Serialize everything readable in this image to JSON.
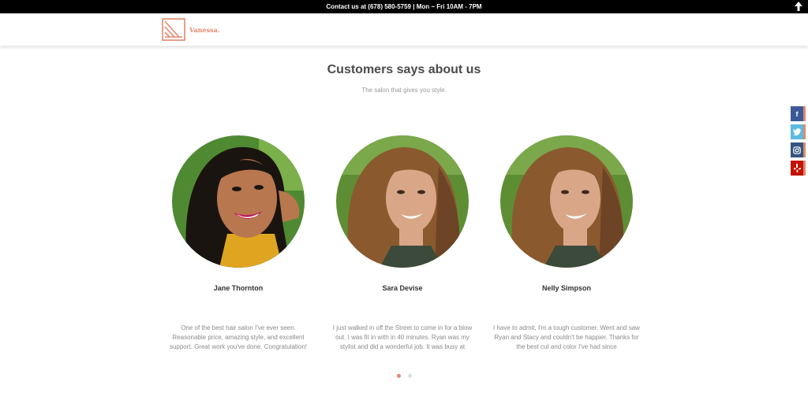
{
  "topbar": {
    "text": "Contact us at (678) 580-5759 | Mon ~ Fri 10AM - 7PM"
  },
  "brand": {
    "name": "Vanessa."
  },
  "section": {
    "title": "Customers says about us",
    "subtitle": "The salon that gives you style."
  },
  "testimonials": [
    {
      "name": "Jane Thornton",
      "quote": "One of the best hair salon I've ever seen. Reasonable price, amazing style, and excellent support. Great work you've done. Congratulation!"
    },
    {
      "name": "Sara Devise",
      "quote": "I just walked in off the Street to come in for a blow out. I was fit in with in 40 minutes. Ryan was my stylist and did a wonderful job. It was busy at"
    },
    {
      "name": "Nelly Simpson",
      "quote": "I have to admit, I'm a tough customer. Went and saw Ryan and Stacy and couldn't be happier. Thanks for the best cut and color I've had since"
    }
  ],
  "carousel": {
    "page_count": 2,
    "active_index": 0
  },
  "social": [
    "facebook-icon",
    "twitter-icon",
    "instagram-icon",
    "yelp-icon"
  ],
  "colors": {
    "accent": "#e0896c",
    "topbar": "#000000"
  }
}
